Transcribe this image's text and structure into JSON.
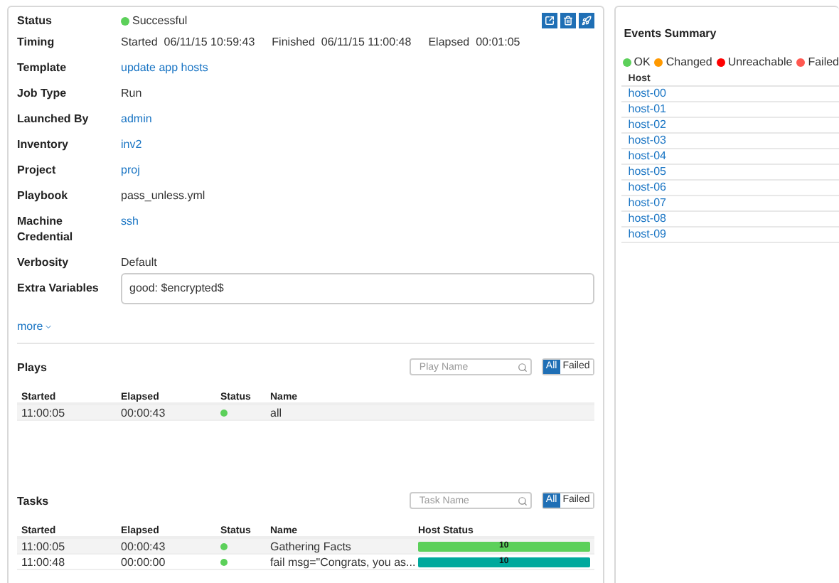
{
  "job": {
    "fields": [
      {
        "label": "Status",
        "kind": "status",
        "value": "Successful",
        "color": "#5cd05a"
      },
      {
        "label": "Timing",
        "kind": "timing",
        "parts": [
          {
            "label": "Started",
            "value": "06/11/15 10:59:43"
          },
          {
            "label": "Finished",
            "value": "06/11/15 11:00:48"
          },
          {
            "label": "Elapsed",
            "value": "00:01:05"
          }
        ]
      },
      {
        "label": "Template",
        "kind": "link",
        "value": "update app hosts"
      },
      {
        "label": "Job Type",
        "kind": "text",
        "value": "Run"
      },
      {
        "label": "Launched By",
        "kind": "link",
        "value": "admin"
      },
      {
        "label": "Inventory",
        "kind": "link",
        "value": "inv2"
      },
      {
        "label": "Project",
        "kind": "link",
        "value": "proj"
      },
      {
        "label": "Playbook",
        "kind": "text",
        "value": "pass_unless.yml"
      },
      {
        "label": "Machine Credential",
        "kind": "link",
        "value": "ssh"
      },
      {
        "label": "Verbosity",
        "kind": "text",
        "value": "Default"
      },
      {
        "label": "Extra Variables",
        "kind": "code",
        "value": "good: $encrypted$"
      }
    ],
    "more": "more"
  },
  "plays": {
    "title": "Plays",
    "search": {
      "placeholder": "Play Name"
    },
    "filters": [
      {
        "label": "All",
        "selected": true
      },
      {
        "label": "Failed",
        "selected": false
      }
    ],
    "columns": [
      "Started",
      "Elapsed",
      "Status",
      "Name"
    ],
    "rows": [
      {
        "started": "11:00:05",
        "elapsed": "00:00:43",
        "successful": true,
        "name": "all"
      }
    ]
  },
  "tasks": {
    "title": "Tasks",
    "search": {
      "placeholder": "Task Name"
    },
    "filters": [
      {
        "label": "All",
        "selected": true
      },
      {
        "label": "Failed",
        "selected": false
      }
    ],
    "columns": [
      "Started",
      "Elapsed",
      "Status",
      "Name",
      "Host Status"
    ],
    "rows": [
      {
        "started": "11:00:05",
        "elapsed": "00:00:43",
        "successful": true,
        "name": "Gathering Facts",
        "host_count": "10",
        "color": "#5cd05a"
      },
      {
        "started": "11:00:48",
        "elapsed": "00:00:00",
        "successful": true,
        "name": "fail msg=\"Congrats, you as...",
        "host_count": "10",
        "color": "#00a99d"
      }
    ]
  },
  "events_summary": {
    "title": "Events Summary",
    "legend": [
      {
        "label": "OK",
        "color": "#5cd05a"
      },
      {
        "label": "Changed",
        "color": "#ff9900"
      },
      {
        "label": "Unreachable",
        "color": "#ff0000"
      },
      {
        "label": "Failed",
        "color": "#ff5850"
      }
    ],
    "column": "Host",
    "hosts": [
      "host-00",
      "host-01",
      "host-02",
      "host-03",
      "host-04",
      "host-05",
      "host-06",
      "host-07",
      "host-08",
      "host-09"
    ]
  }
}
